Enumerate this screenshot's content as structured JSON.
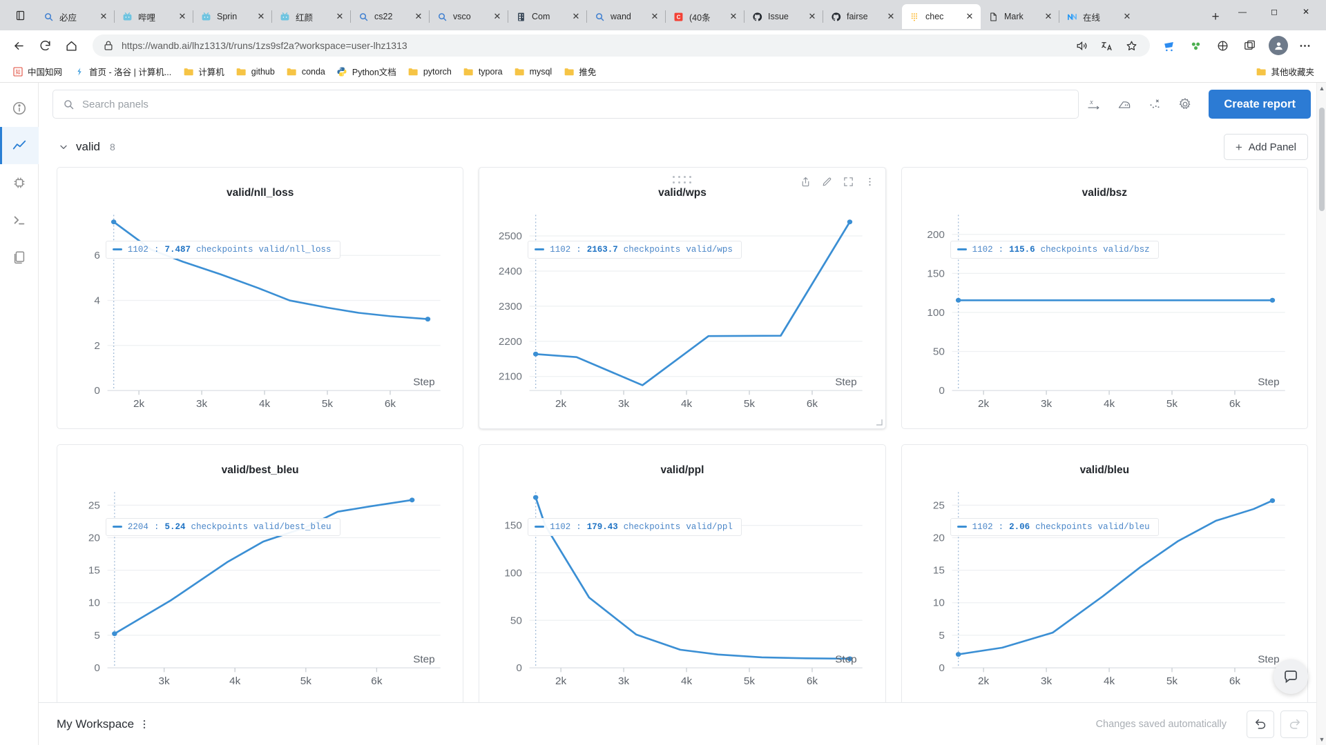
{
  "browser": {
    "tabs": [
      {
        "title": "必应",
        "icon": "search-icon",
        "active": false
      },
      {
        "title": "哔哩",
        "icon": "bilibili-icon",
        "active": false
      },
      {
        "title": "Sprin",
        "icon": "bilibili-icon",
        "active": false
      },
      {
        "title": "红颜",
        "icon": "bilibili-icon",
        "active": false
      },
      {
        "title": "cs22",
        "icon": "search-icon",
        "active": false
      },
      {
        "title": "vsco",
        "icon": "search-icon",
        "active": false
      },
      {
        "title": "Com",
        "icon": "server-icon",
        "active": false
      },
      {
        "title": "wand",
        "icon": "search-icon",
        "active": false
      },
      {
        "title": "(40条",
        "icon": "csdn-icon",
        "active": false
      },
      {
        "title": "Issue",
        "icon": "github-icon",
        "active": false
      },
      {
        "title": "fairse",
        "icon": "github-icon",
        "active": false
      },
      {
        "title": "chec",
        "icon": "wandb-icon",
        "active": true
      },
      {
        "title": "Mark",
        "icon": "file-icon",
        "active": false
      },
      {
        "title": "在线",
        "icon": "nav-icon",
        "active": false
      }
    ],
    "newtab_label": "+",
    "window": {
      "minimize": "—",
      "maximize": "❐",
      "close": "✕"
    },
    "address": {
      "url_prefix": "https://",
      "url_domain": "wandb.ai",
      "url_path": "/lhz1313/t/runs/1zs9sf2a?workspace=user-lhz1313",
      "full_url": "https://wandb.ai/lhz1313/t/runs/1zs9sf2a?workspace=user-lhz1313"
    },
    "bookmarks": [
      {
        "label": "中国知网",
        "icon": "cnki-icon"
      },
      {
        "label": "首页 - 洛谷 | 计算机...",
        "icon": "luogu-icon"
      },
      {
        "label": "计算机",
        "icon": "folder-icon"
      },
      {
        "label": "github",
        "icon": "folder-icon"
      },
      {
        "label": "conda",
        "icon": "folder-icon"
      },
      {
        "label": "Python文档",
        "icon": "python-icon"
      },
      {
        "label": "pytorch",
        "icon": "folder-icon"
      },
      {
        "label": "typora",
        "icon": "folder-icon"
      },
      {
        "label": "mysql",
        "icon": "folder-icon"
      },
      {
        "label": "推免",
        "icon": "folder-icon"
      }
    ],
    "bookmarks_overflow": {
      "label": "其他收藏夹",
      "icon": "folder-icon"
    }
  },
  "app": {
    "rail": [
      {
        "name": "overview",
        "icon": "info-icon",
        "active": false
      },
      {
        "name": "charts",
        "icon": "chart-line-icon",
        "active": true
      },
      {
        "name": "system",
        "icon": "cpu-icon",
        "active": false
      },
      {
        "name": "logs",
        "icon": "terminal-icon",
        "active": false
      },
      {
        "name": "files",
        "icon": "files-icon",
        "active": false
      }
    ],
    "search": {
      "placeholder": "Search panels",
      "value": ""
    },
    "toolbar_icons": [
      {
        "name": "x-axis-icon",
        "glyph": "x-axis"
      },
      {
        "name": "smoothing-icon",
        "glyph": "iron"
      },
      {
        "name": "scatter-icon",
        "glyph": "scatter"
      },
      {
        "name": "settings-icon",
        "glyph": "gear"
      }
    ],
    "create_report_label": "Create report",
    "section": {
      "name": "valid",
      "count": "8",
      "add_panel_label": "Add Panel"
    },
    "footer": {
      "workspace": "My Workspace",
      "saved_message": "Changes saved automatically",
      "undo_label": "undo-icon",
      "redo_label": "redo-icon"
    }
  },
  "chart_data": [
    {
      "type": "line",
      "title": "valid/nll_loss",
      "xlabel": "Step",
      "ylabel": "",
      "legend": {
        "run": "1102",
        "value": "7.487",
        "group": "checkpoints",
        "metric": "valid/nll_loss"
      },
      "yticks": [
        "0",
        "2",
        "4",
        "6"
      ],
      "xticks": [
        "2k",
        "3k",
        "4k",
        "5k",
        "6k"
      ],
      "ylim": [
        0,
        7.8
      ],
      "xlim": [
        1500,
        6800
      ],
      "x": [
        1600,
        2200,
        2700,
        3300,
        3900,
        4400,
        5000,
        5500,
        6000,
        6600
      ],
      "values": [
        7.487,
        6.25,
        5.72,
        5.16,
        4.55,
        4.0,
        3.68,
        3.45,
        3.3,
        3.17
      ],
      "color": "#3b8fd4",
      "grid": true,
      "legend_position": "top-left"
    },
    {
      "type": "line",
      "title": "valid/wps",
      "xlabel": "Step",
      "ylabel": "",
      "legend": {
        "run": "1102",
        "value": "2163.7",
        "group": "checkpoints",
        "metric": "valid/wps"
      },
      "yticks": [
        "2100",
        "2200",
        "2300",
        "2400",
        "2500"
      ],
      "xticks": [
        "2k",
        "3k",
        "4k",
        "5k",
        "6k"
      ],
      "ylim": [
        2060,
        2560
      ],
      "xlim": [
        1500,
        6800
      ],
      "x": [
        1600,
        2250,
        3300,
        4350,
        5500,
        6600
      ],
      "values": [
        2163.7,
        2155,
        2075,
        2215,
        2216,
        2540
      ],
      "color": "#3b8fd4",
      "grid": true,
      "legend_position": "top-left"
    },
    {
      "type": "line",
      "title": "valid/bsz",
      "xlabel": "Step",
      "ylabel": "",
      "legend": {
        "run": "1102",
        "value": "115.6",
        "group": "checkpoints",
        "metric": "valid/bsz"
      },
      "yticks": [
        "0",
        "50",
        "100",
        "150",
        "200"
      ],
      "xticks": [
        "2k",
        "3k",
        "4k",
        "5k",
        "6k"
      ],
      "ylim": [
        0,
        225
      ],
      "xlim": [
        1500,
        6800
      ],
      "x": [
        1600,
        6600
      ],
      "values": [
        115.6,
        115.6
      ],
      "color": "#3b8fd4",
      "grid": true,
      "legend_position": "top-left"
    },
    {
      "type": "line",
      "title": "valid/best_bleu",
      "xlabel": "Step",
      "ylabel": "",
      "legend": {
        "run": "2204",
        "value": "5.24",
        "group": "checkpoints",
        "metric": "valid/best_bleu"
      },
      "yticks": [
        "0",
        "5",
        "10",
        "15",
        "20",
        "25"
      ],
      "xticks": [
        "3k",
        "4k",
        "5k",
        "6k"
      ],
      "ylim": [
        0,
        27
      ],
      "xlim": [
        2200,
        6900
      ],
      "x": [
        2300,
        3100,
        3900,
        4400,
        5000,
        5450,
        5900,
        6500
      ],
      "values": [
        5.24,
        10.4,
        16.3,
        19.4,
        21.6,
        24.0,
        24.8,
        25.8
      ],
      "color": "#3b8fd4",
      "grid": true,
      "legend_position": "top-left"
    },
    {
      "type": "line",
      "title": "valid/ppl",
      "xlabel": "Step",
      "ylabel": "",
      "legend": {
        "run": "1102",
        "value": "179.43",
        "group": "checkpoints",
        "metric": "valid/ppl"
      },
      "yticks": [
        "0",
        "50",
        "100",
        "150"
      ],
      "xticks": [
        "2k",
        "3k",
        "4k",
        "5k",
        "6k"
      ],
      "ylim": [
        0,
        185
      ],
      "xlim": [
        1500,
        6800
      ],
      "x": [
        1600,
        1750,
        2450,
        3200,
        3900,
        4500,
        5200,
        5900,
        6600
      ],
      "values": [
        179.43,
        150,
        74,
        35,
        19,
        14,
        11,
        10,
        9.5
      ],
      "color": "#3b8fd4",
      "grid": true,
      "legend_position": "top-left"
    },
    {
      "type": "line",
      "title": "valid/bleu",
      "xlabel": "Step",
      "ylabel": "",
      "legend": {
        "run": "1102",
        "value": "2.06",
        "group": "checkpoints",
        "metric": "valid/bleu"
      },
      "yticks": [
        "0",
        "5",
        "10",
        "15",
        "20",
        "25"
      ],
      "xticks": [
        "2k",
        "3k",
        "4k",
        "5k",
        "6k"
      ],
      "ylim": [
        0,
        27
      ],
      "xlim": [
        1500,
        6800
      ],
      "x": [
        1600,
        2300,
        3100,
        3900,
        4500,
        5100,
        5700,
        6300,
        6600
      ],
      "values": [
        2.06,
        3.1,
        5.4,
        11.0,
        15.5,
        19.5,
        22.6,
        24.4,
        25.7
      ],
      "color": "#3b8fd4",
      "grid": true,
      "legend_position": "top-left"
    }
  ]
}
